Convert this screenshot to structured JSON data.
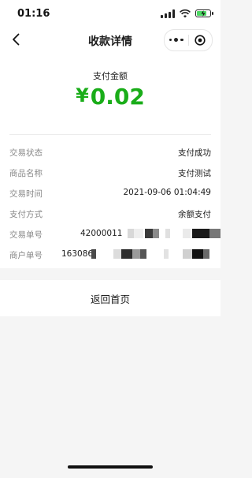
{
  "status_bar": {
    "time": "01:16"
  },
  "nav": {
    "title": "收款详情"
  },
  "payment": {
    "amount_label": "支付金额",
    "currency_symbol": "¥",
    "amount": "0.02",
    "accent_color": "#1aad19"
  },
  "details": [
    {
      "label": "交易状态",
      "value": "支付成功"
    },
    {
      "label": "商品名称",
      "value": "支付测试"
    },
    {
      "label": "交易时间",
      "value": "2021-09-06 01:04:49"
    },
    {
      "label": "支付方式",
      "value": "余额支付"
    },
    {
      "label": "交易单号",
      "value": "42000011"
    },
    {
      "label": "商户单号",
      "value": "163086"
    }
  ],
  "footer": {
    "back_home": "返回首页"
  }
}
